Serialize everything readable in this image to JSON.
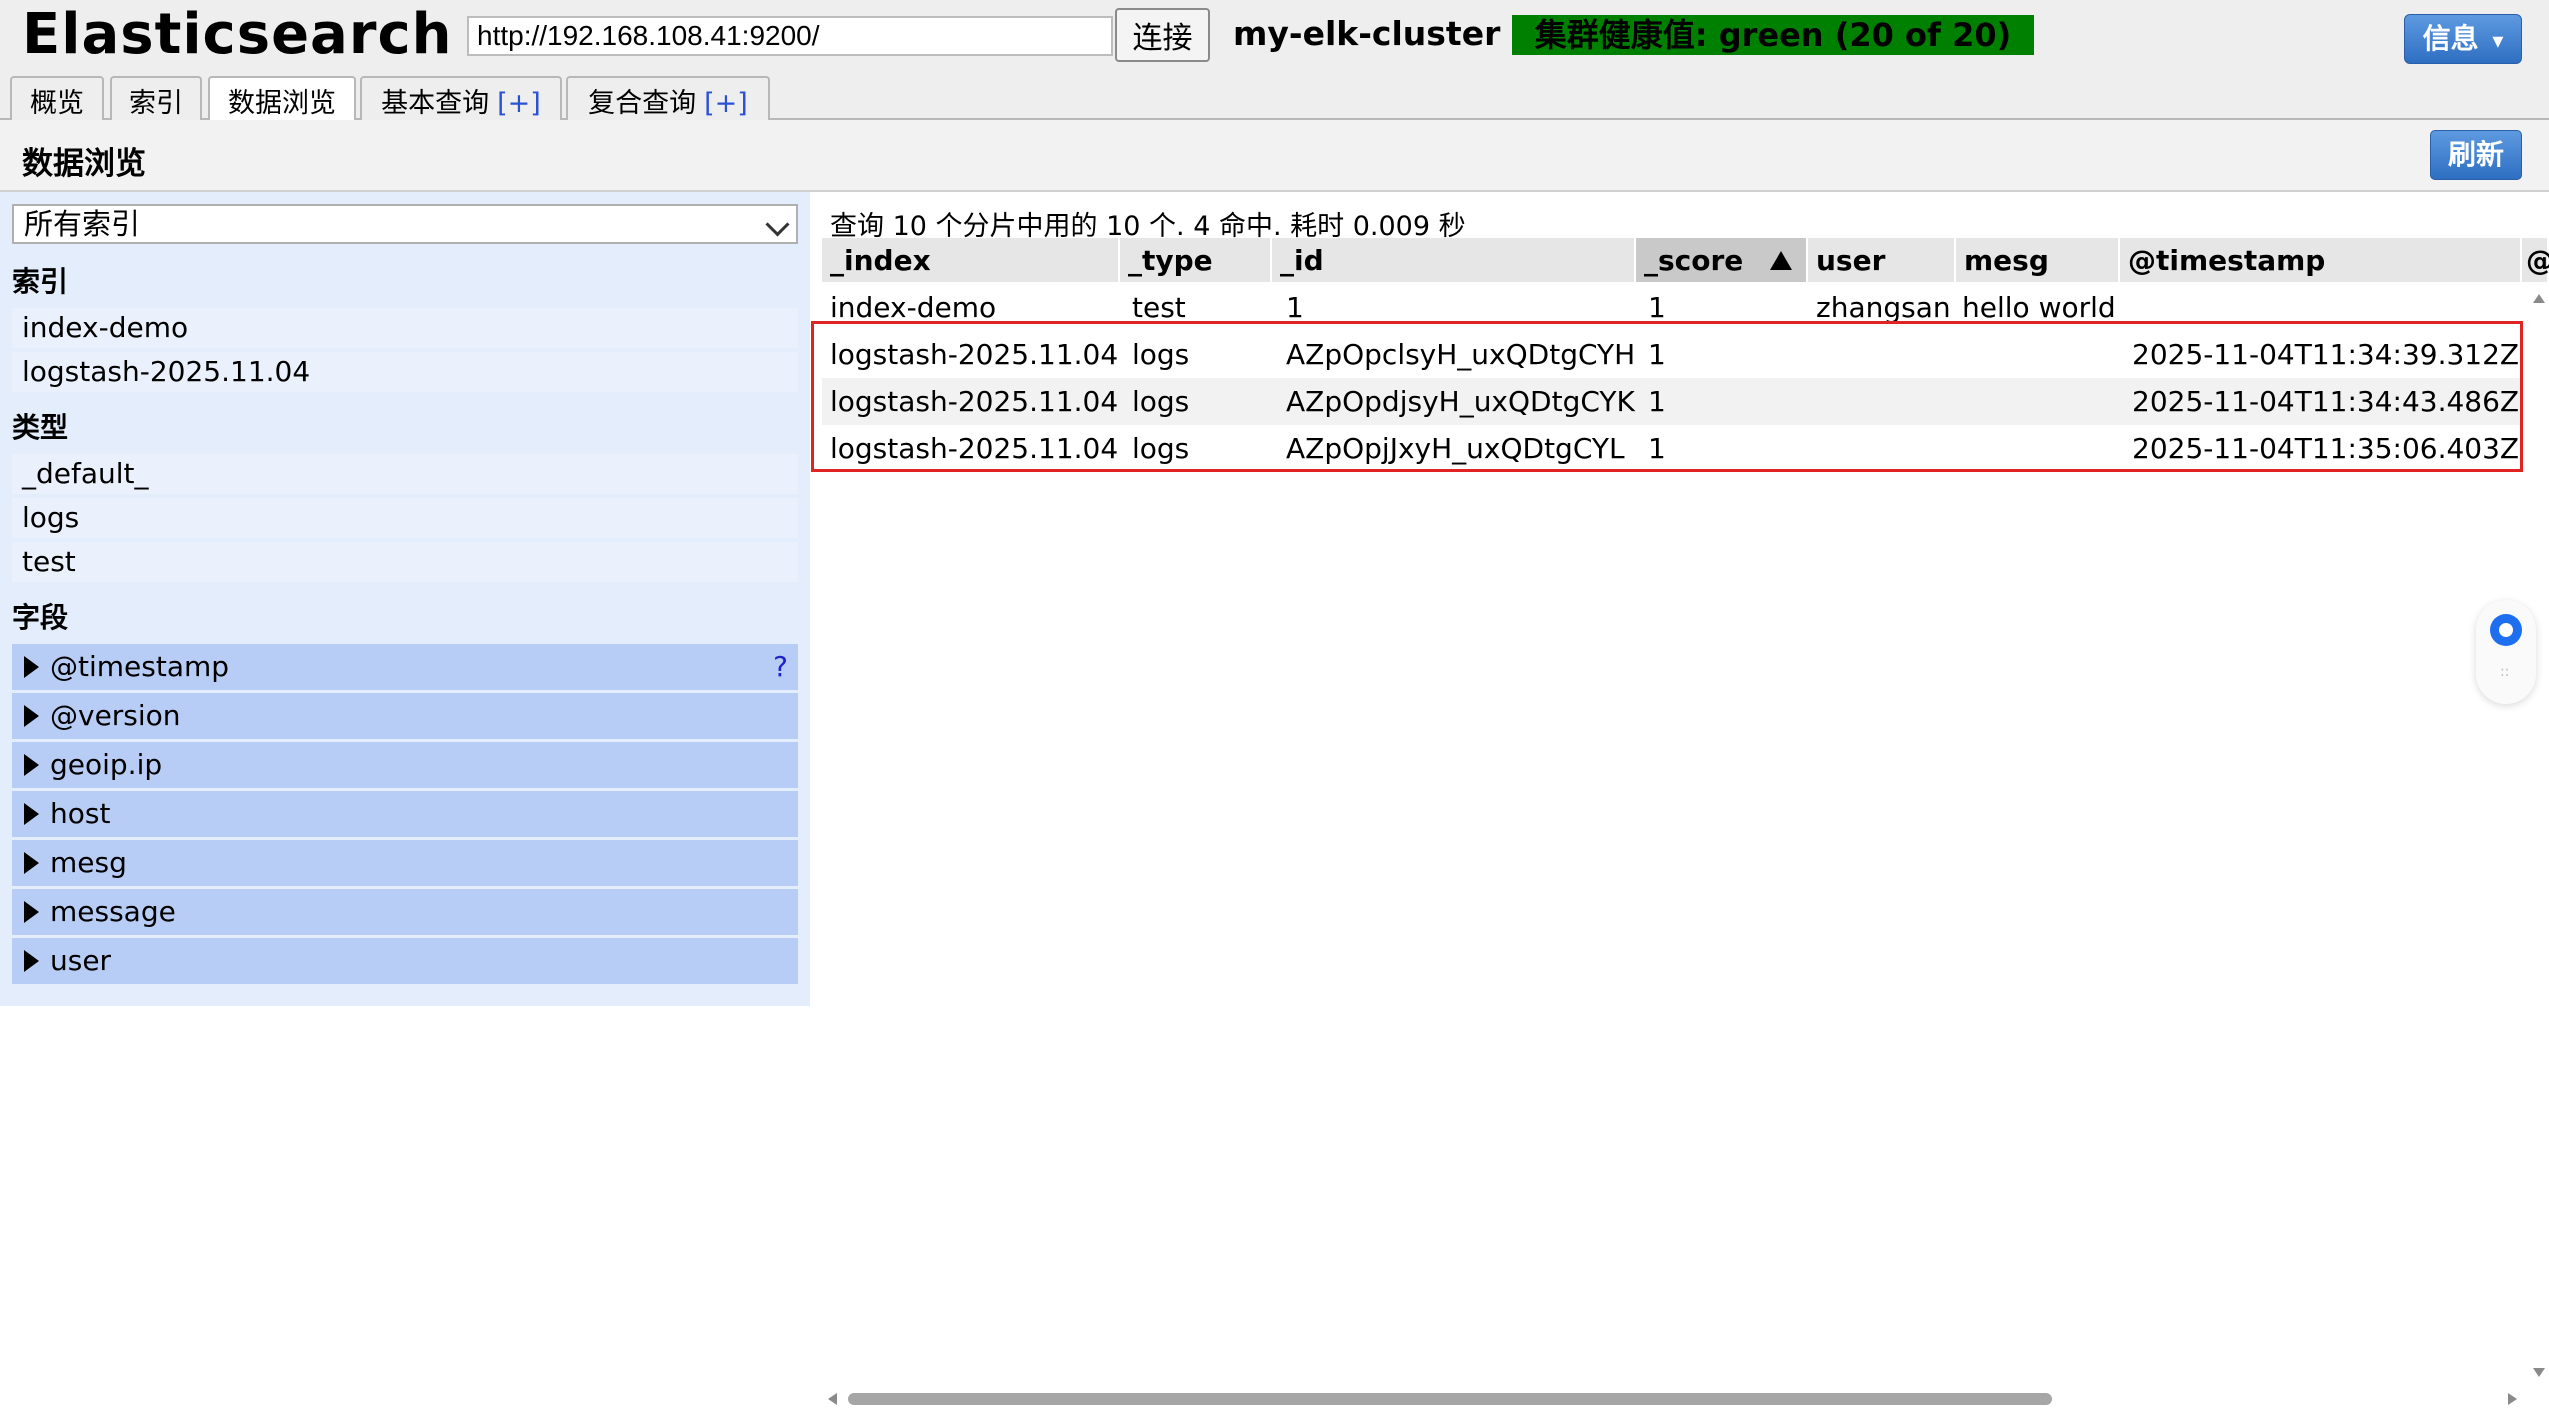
{
  "header": {
    "app_title": "Elasticsearch",
    "url_value": "http://192.168.108.41:9200/",
    "connect_label": "连接",
    "cluster_name": "my-elk-cluster",
    "health_text": "集群健康值: green (20 of 20)",
    "health_color": "#008000",
    "info_label": "信息",
    "info_caret": "▾"
  },
  "tabs": [
    {
      "label": "概览",
      "plus": ""
    },
    {
      "label": "索引",
      "plus": ""
    },
    {
      "label": "数据浏览",
      "plus": "",
      "active": true
    },
    {
      "label": "基本查询",
      "plus": "[+]"
    },
    {
      "label": "复合查询",
      "plus": "[+]"
    }
  ],
  "section": {
    "title": "数据浏览",
    "refresh_label": "刷新"
  },
  "sidebar": {
    "index_select": "所有索引",
    "indices_label": "索引",
    "indices": [
      "index-demo",
      "logstash-2025.11.04"
    ],
    "types_label": "类型",
    "types": [
      "_default_",
      "logs",
      "test"
    ],
    "fields_label": "字段",
    "fields": [
      "@timestamp",
      "@version",
      "geoip.ip",
      "host",
      "mesg",
      "message",
      "user"
    ],
    "help_mark": "?"
  },
  "results": {
    "summary": "查询 10 个分片中用的 10 个. 4 命中. 耗时 0.009 秒",
    "columns": [
      "_index",
      "_type",
      "_id",
      "_score",
      "user",
      "mesg",
      "@timestamp",
      "@"
    ],
    "sorted_column": "_score",
    "rows": [
      [
        "index-demo",
        "test",
        "1",
        "1",
        "zhangsan",
        "hello world",
        ""
      ],
      [
        "logstash-2025.11.04",
        "logs",
        "AZpOpclsyH_uxQDtgCYH",
        "1",
        "",
        "",
        "2025-11-04T11:34:39.312Z"
      ],
      [
        "logstash-2025.11.04",
        "logs",
        "AZpOpdjsyH_uxQDtgCYK",
        "1",
        "",
        "",
        "2025-11-04T11:34:43.486Z"
      ],
      [
        "logstash-2025.11.04",
        "logs",
        "AZpOpjJxyH_uxQDtgCYL",
        "1",
        "",
        "",
        "2025-11-04T11:35:06.403Z"
      ]
    ],
    "highlight_color": "#e02424"
  },
  "widget": {
    "icon": "assistant-bubble-icon",
    "grip": "::"
  }
}
